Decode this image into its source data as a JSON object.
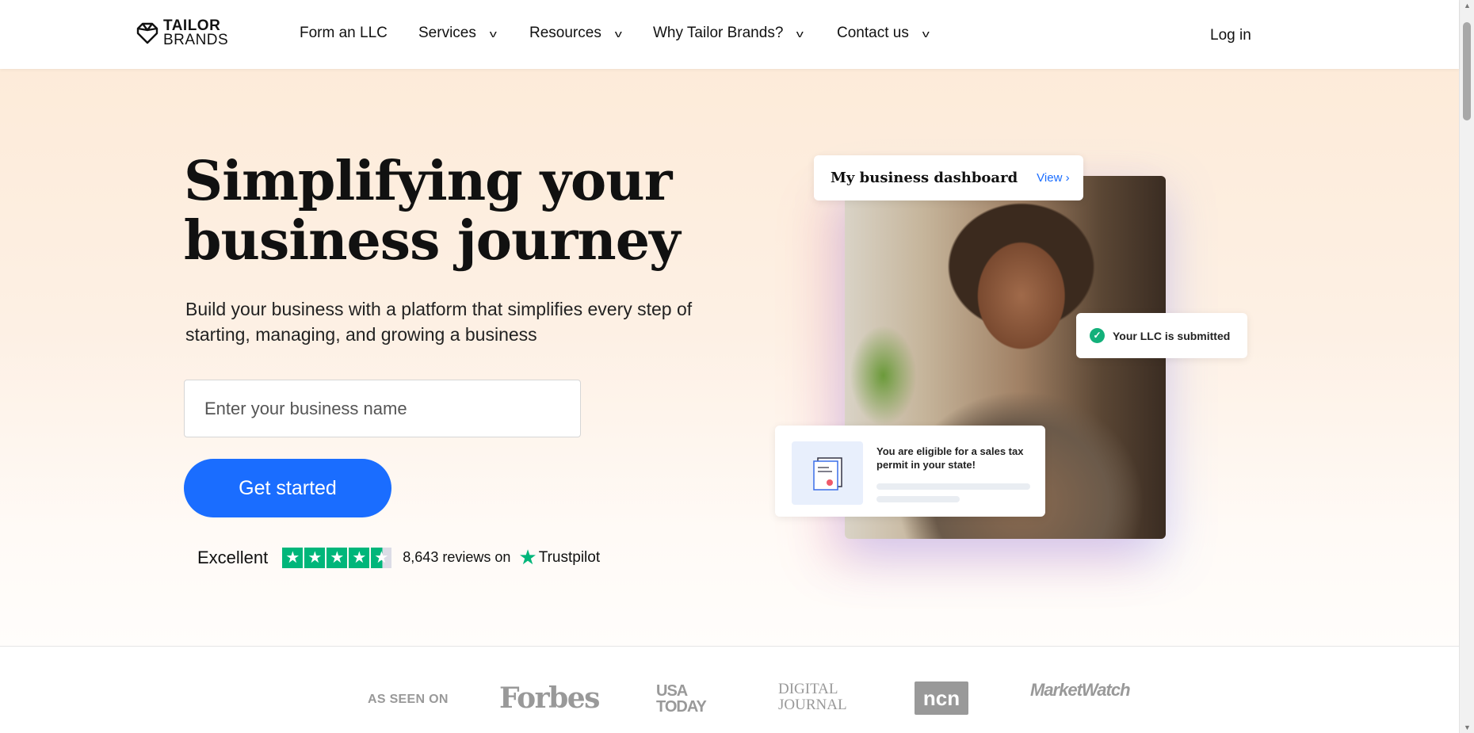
{
  "header": {
    "logo_line1": "TAILOR",
    "logo_line2": "BRANDS",
    "nav": [
      {
        "label": "Form an LLC",
        "dropdown": false
      },
      {
        "label": "Services",
        "dropdown": true
      },
      {
        "label": "Resources",
        "dropdown": true
      },
      {
        "label": "Why Tailor Brands?",
        "dropdown": true
      },
      {
        "label": "Contact us",
        "dropdown": true
      }
    ],
    "login": "Log in"
  },
  "hero": {
    "title_line1": "Simplifying your",
    "title_line2": "business journey",
    "subtitle": "Build your business with a platform that simplifies every step of starting, managing, and growing a business",
    "input_placeholder": "Enter your business name",
    "cta": "Get started",
    "trustpilot": {
      "rating_word": "Excellent",
      "stars": 4.5,
      "reviews": "8,643 reviews on",
      "brand": "Trustpilot",
      "color": "#00b67a"
    }
  },
  "visual": {
    "dashboard_title": "My business dashboard",
    "view_link": "View",
    "llc_status": "Your LLC is submitted",
    "eligibility": "You are eligible for a sales tax permit in your state!"
  },
  "press": {
    "label": "AS SEEN ON",
    "logos": [
      "Forbes",
      "USA TODAY",
      "DIGITAL JOURNAL",
      "ncn",
      "MarketWatch"
    ]
  },
  "colors": {
    "accent": "#1a6dff",
    "success": "#13b07a",
    "hero_bg": "#fdebd9"
  }
}
